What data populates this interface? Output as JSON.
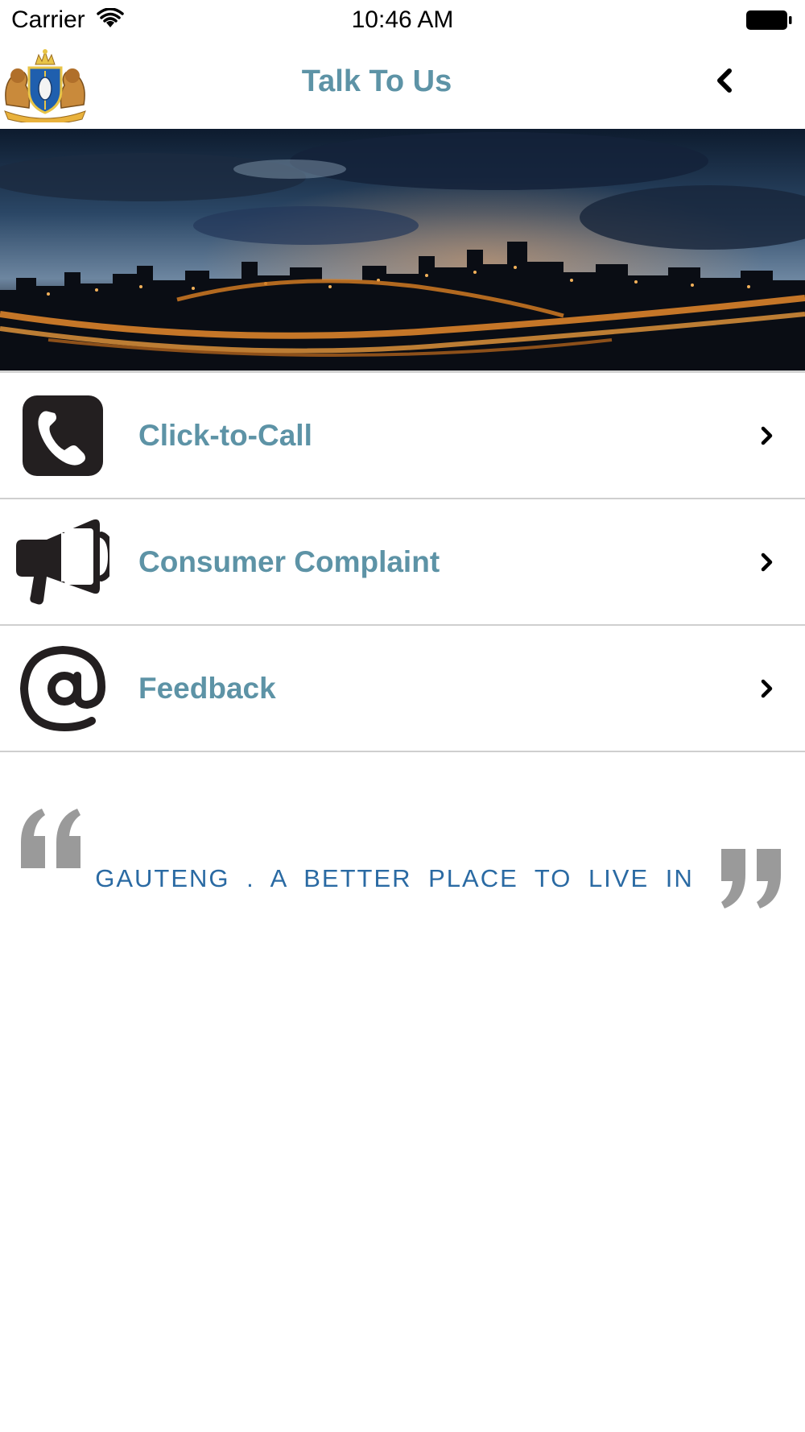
{
  "status_bar": {
    "carrier": "Carrier",
    "time": "10:46 AM"
  },
  "nav": {
    "title": "Talk To Us",
    "logo_icon": "coat-of-arms-icon",
    "back_icon": "chevron-left-icon"
  },
  "hero": {
    "icon": "city-night-skyline-image"
  },
  "menu": {
    "items": [
      {
        "label": "Click-to-Call",
        "icon": "phone-icon"
      },
      {
        "label": "Consumer Complaint",
        "icon": "megaphone-icon"
      },
      {
        "label": "Feedback",
        "icon": "at-sign-icon"
      }
    ]
  },
  "quote": {
    "text": "GAUTENG . A BETTER PLACE TO LIVE IN"
  },
  "colors": {
    "accent": "#5d93a6",
    "slogan": "#2a6aa3",
    "quote_marks": "#9a9a9a",
    "divider": "#cfcfcf"
  }
}
